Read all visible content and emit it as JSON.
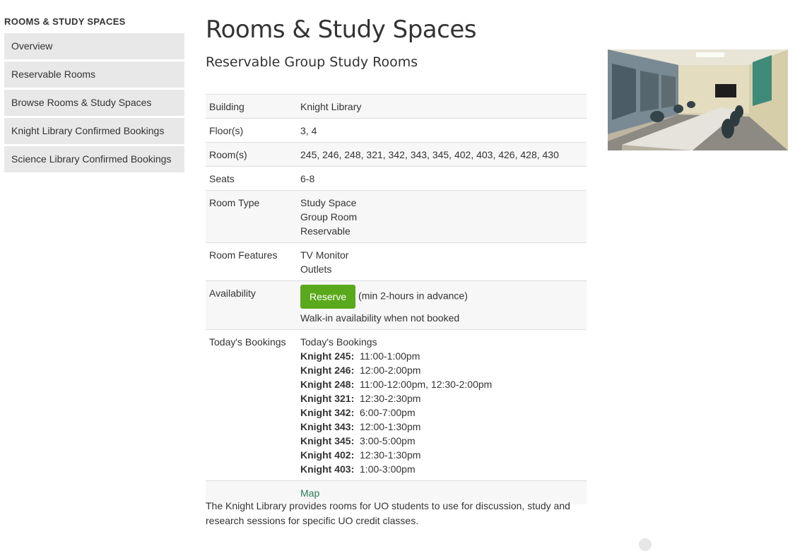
{
  "sidebar": {
    "heading": "ROOMS & STUDY SPACES",
    "items": [
      {
        "label": "Overview"
      },
      {
        "label": "Reservable Rooms"
      },
      {
        "label": "Browse Rooms & Study Spaces"
      },
      {
        "label": "Knight Library Confirmed Bookings"
      },
      {
        "label": "Science Library Confirmed Bookings"
      }
    ]
  },
  "main": {
    "title": "Rooms & Study Spaces",
    "subtitle": "Reservable Group Study Rooms",
    "table": {
      "building": {
        "label": "Building",
        "value": "Knight Library"
      },
      "floors": {
        "label": "Floor(s)",
        "value": "3, 4"
      },
      "rooms": {
        "label": "Room(s)",
        "value": "245, 246, 248, 321, 342, 343, 345, 402, 403, 426, 428, 430"
      },
      "seats": {
        "label": "Seats",
        "value": "6-8"
      },
      "room_type": {
        "label": "Room Type",
        "values": [
          "Study Space",
          "Group Room",
          "Reservable"
        ]
      },
      "room_features": {
        "label": "Room Features",
        "values": [
          "TV Monitor",
          "Outlets"
        ]
      },
      "availability": {
        "label": "Availability",
        "button": "Reserve",
        "note": "(min 2-hours in advance)",
        "walkin": "Walk-in availability when not booked"
      },
      "bookings": {
        "label": "Today's Bookings",
        "heading": "Today's Bookings",
        "items": [
          {
            "room": "Knight 245:",
            "times": "11:00-1:00pm"
          },
          {
            "room": "Knight 246:",
            "times": "12:00-2:00pm"
          },
          {
            "room": "Knight 248:",
            "times": "11:00-12:00pm, 12:30-2:00pm"
          },
          {
            "room": "Knight 321:",
            "times": "12:30-2:30pm"
          },
          {
            "room": "Knight 342:",
            "times": "6:00-7:00pm"
          },
          {
            "room": "Knight 343:",
            "times": "12:00-1:30pm"
          },
          {
            "room": "Knight 345:",
            "times": "3:00-5:00pm"
          },
          {
            "room": "Knight 402:",
            "times": "12:30-1:30pm"
          },
          {
            "room": "Knight 403:",
            "times": "1:00-3:00pm"
          }
        ]
      },
      "map_link": "Map"
    },
    "intro": "The Knight Library provides rooms for UO students to use for discussion, study and research sessions for specific UO credit classes."
  },
  "colors": {
    "reserve_button": "#5aa91c",
    "sidebar_item_bg": "#e8e8e8",
    "link": "#2a7a57"
  },
  "icons": {
    "room_photo": "study-room-photo"
  }
}
